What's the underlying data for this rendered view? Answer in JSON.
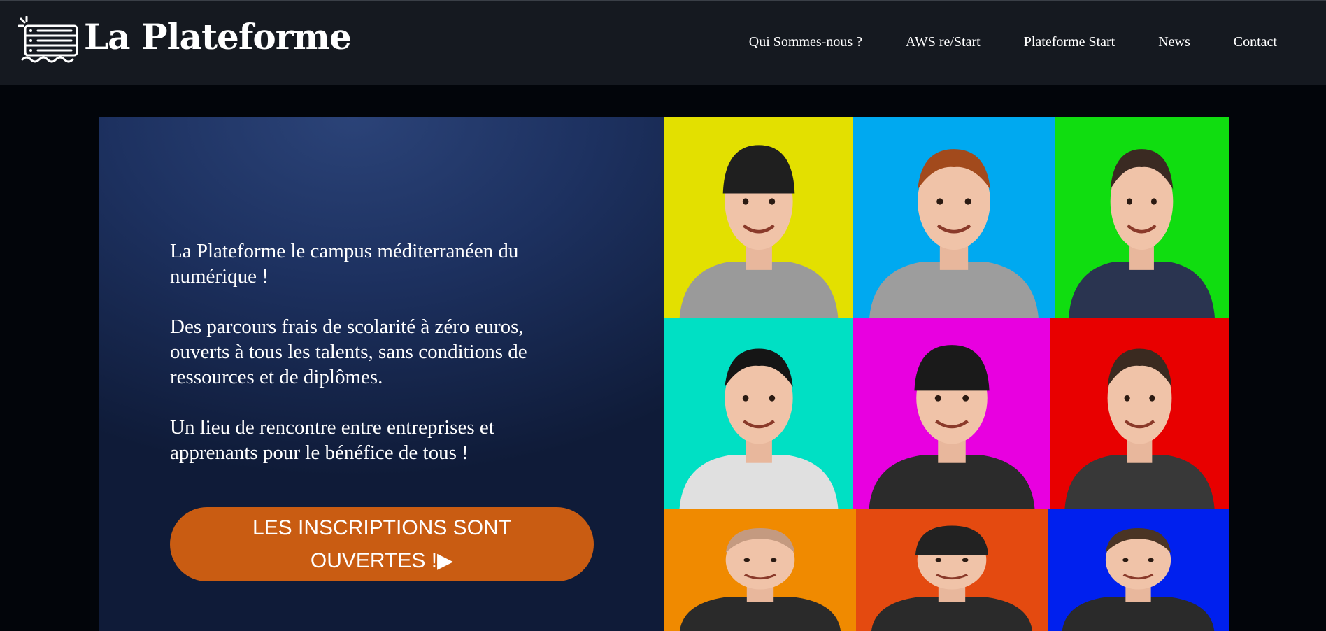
{
  "brand": {
    "name": "La Plateforme",
    "logo_icon": "server-rack-icon"
  },
  "nav": {
    "items": [
      {
        "label": "Qui Sommes-nous ?"
      },
      {
        "label": "AWS re/Start"
      },
      {
        "label": "Plateforme Start"
      },
      {
        "label": "News"
      },
      {
        "label": "Contact"
      }
    ]
  },
  "hero": {
    "paragraphs": [
      "La Plateforme le campus méditerranéen du numérique !",
      "Des parcours frais de scolarité à zéro euros, ouverts à tous les talents, sans conditions de ressources et de diplômes.",
      "Un lieu de rencontre entre entreprises et apprenants pour le bénéfice de tous !"
    ],
    "cta_label": "LES INSCRIPTIONS SONT OUVERTES !▶"
  },
  "portraits": [
    {
      "bg": "#e3e000",
      "shirt": "#9a9a9a",
      "hair": "#1f1f1f",
      "cap": true
    },
    {
      "bg": "#00a9f0",
      "shirt": "#9d9d9d",
      "hair": "#a24a1c",
      "cap": false
    },
    {
      "bg": "#10dd10",
      "shirt": "#2a3450",
      "hair": "#3a2a22",
      "cap": false
    },
    {
      "bg": "#00e0c4",
      "shirt": "#e0e0e0",
      "hair": "#151515",
      "cap": false
    },
    {
      "bg": "#e800e0",
      "shirt": "#2b2b2b",
      "hair": "#1a1a1a",
      "cap": true
    },
    {
      "bg": "#e80000",
      "shirt": "#383838",
      "hair": "#3a2a20",
      "cap": false
    },
    {
      "bg": "#f08a00",
      "shirt": "#2a2a2a",
      "hair": "#c49a80",
      "cap": false
    },
    {
      "bg": "#e44a10",
      "shirt": "#2a2a2a",
      "hair": "#222222",
      "cap": true
    },
    {
      "bg": "#0020ee",
      "shirt": "#2a2a2a",
      "hair": "#4a3424",
      "cap": false
    }
  ],
  "colors": {
    "nav_bg": "#151920",
    "page_bg": "#02050a",
    "hero_bg": "#1d3160",
    "cta_bg": "#c95c12"
  }
}
